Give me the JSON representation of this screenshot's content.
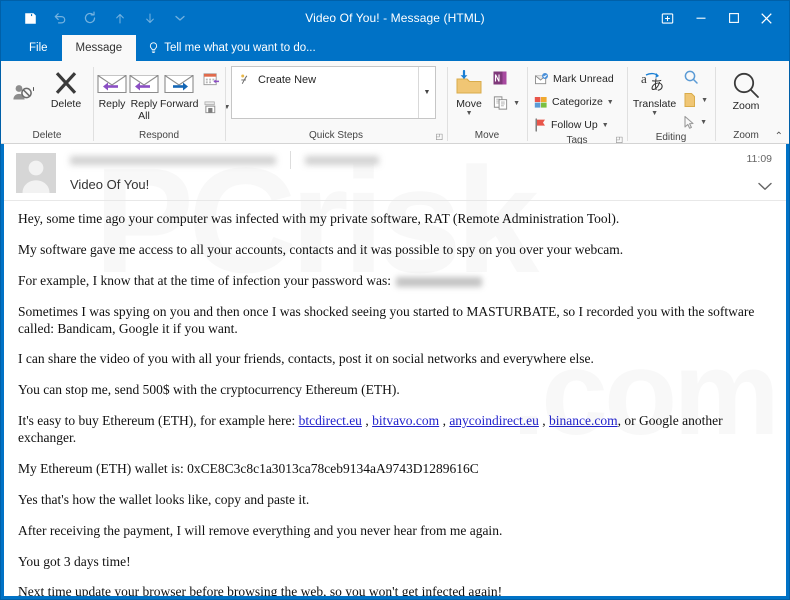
{
  "window": {
    "title": "Video Of You! - Message (HTML)",
    "quick_access": [
      {
        "name": "save-icon",
        "label": "Save"
      },
      {
        "name": "undo-icon",
        "label": "Undo"
      },
      {
        "name": "redo-icon",
        "label": "Redo"
      },
      {
        "name": "previous-item-icon",
        "label": "Previous Item"
      },
      {
        "name": "next-item-icon",
        "label": "Next Item"
      },
      {
        "name": "customize-quick-access-icon",
        "label": "Customize Quick Access Toolbar"
      }
    ],
    "controls": [
      {
        "name": "ribbon-display-options-icon",
        "label": "Ribbon Display Options"
      },
      {
        "name": "minimize-icon",
        "label": "Minimize"
      },
      {
        "name": "maximize-icon",
        "label": "Maximize"
      },
      {
        "name": "close-icon",
        "label": "Close"
      }
    ]
  },
  "tabs": {
    "file": "File",
    "message": "Message",
    "tellme": "Tell me what you want to do..."
  },
  "ribbon": {
    "groups": [
      {
        "label": "Delete"
      },
      {
        "label": "Respond"
      },
      {
        "label": "Quick Steps"
      },
      {
        "label": "Move"
      },
      {
        "label": "Tags"
      },
      {
        "label": "Editing"
      },
      {
        "label": "Zoom"
      }
    ],
    "delete": {
      "junk_label": "",
      "delete_label": "Delete"
    },
    "respond": {
      "reply_label": "Reply",
      "reply_all_label": "Reply\nAll",
      "reply_all_line1": "Reply",
      "reply_all_line2": "All",
      "forward_label": "Forward",
      "meeting_label": "",
      "more_label": ""
    },
    "quick_steps": {
      "create_new": "Create New"
    },
    "move": {
      "move_label": "Move",
      "onenote_label": "",
      "rules_label": ""
    },
    "tags": {
      "mark_unread": "Mark Unread",
      "categorize": "Categorize",
      "follow_up": "Follow Up"
    },
    "editing": {
      "translate_label": "Translate",
      "find_label": "",
      "related_label": "",
      "select_label": ""
    },
    "zoom": {
      "zoom_label": "Zoom"
    },
    "collapse_label": "Collapse the Ribbon"
  },
  "message": {
    "sender_redacted": true,
    "recipient_redacted": true,
    "subject": "Video Of You!",
    "time": "11:09",
    "expand_label": "Expand",
    "body": {
      "p1": "Hey, some time ago your computer was infected with my private software, RAT (Remote Administration Tool).",
      "p2": "My software gave me access to all your accounts, contacts and it was possible to spy on you over your webcam.",
      "p3_prefix": "For example, I know that at the time of infection your password was:",
      "p4": "Sometimes I was spying on you and then once I was shocked seeing you started to MASTURBATE, so I recorded you with the software called: Bandicam, Google it if you want.",
      "p5": "I can share the video of you with all your friends, contacts, post it on social networks and everywhere else.",
      "p6": "You can stop me, send 500$ with the cryptocurrency Ethereum (ETH).",
      "p7_prefix": "It's easy to buy Ethereum (ETH), for example here:",
      "p7_links": [
        "btcdirect.eu",
        "bitvavo.com",
        "anycoindirect.eu",
        "binance.com"
      ],
      "p7_suffix": ", or Google another exchanger.",
      "p8": "My Ethereum (ETH) wallet is: 0xCE8C3c8c1a3013ca78ceb9134aA9743D1289616C",
      "p9": "Yes that's how the wallet looks like, copy and paste it.",
      "p10": "After receiving the payment, I will remove everything and you never hear from me again.",
      "p11": "You got 3 days time!",
      "p12": "Next time update your browser before browsing the web, so you won't get infected again!"
    }
  },
  "colors": {
    "titlebar": "#0072c6",
    "ribbon_bg": "#f9f9f9",
    "link": "#2222cc",
    "pane_bg": "#ffffff"
  }
}
